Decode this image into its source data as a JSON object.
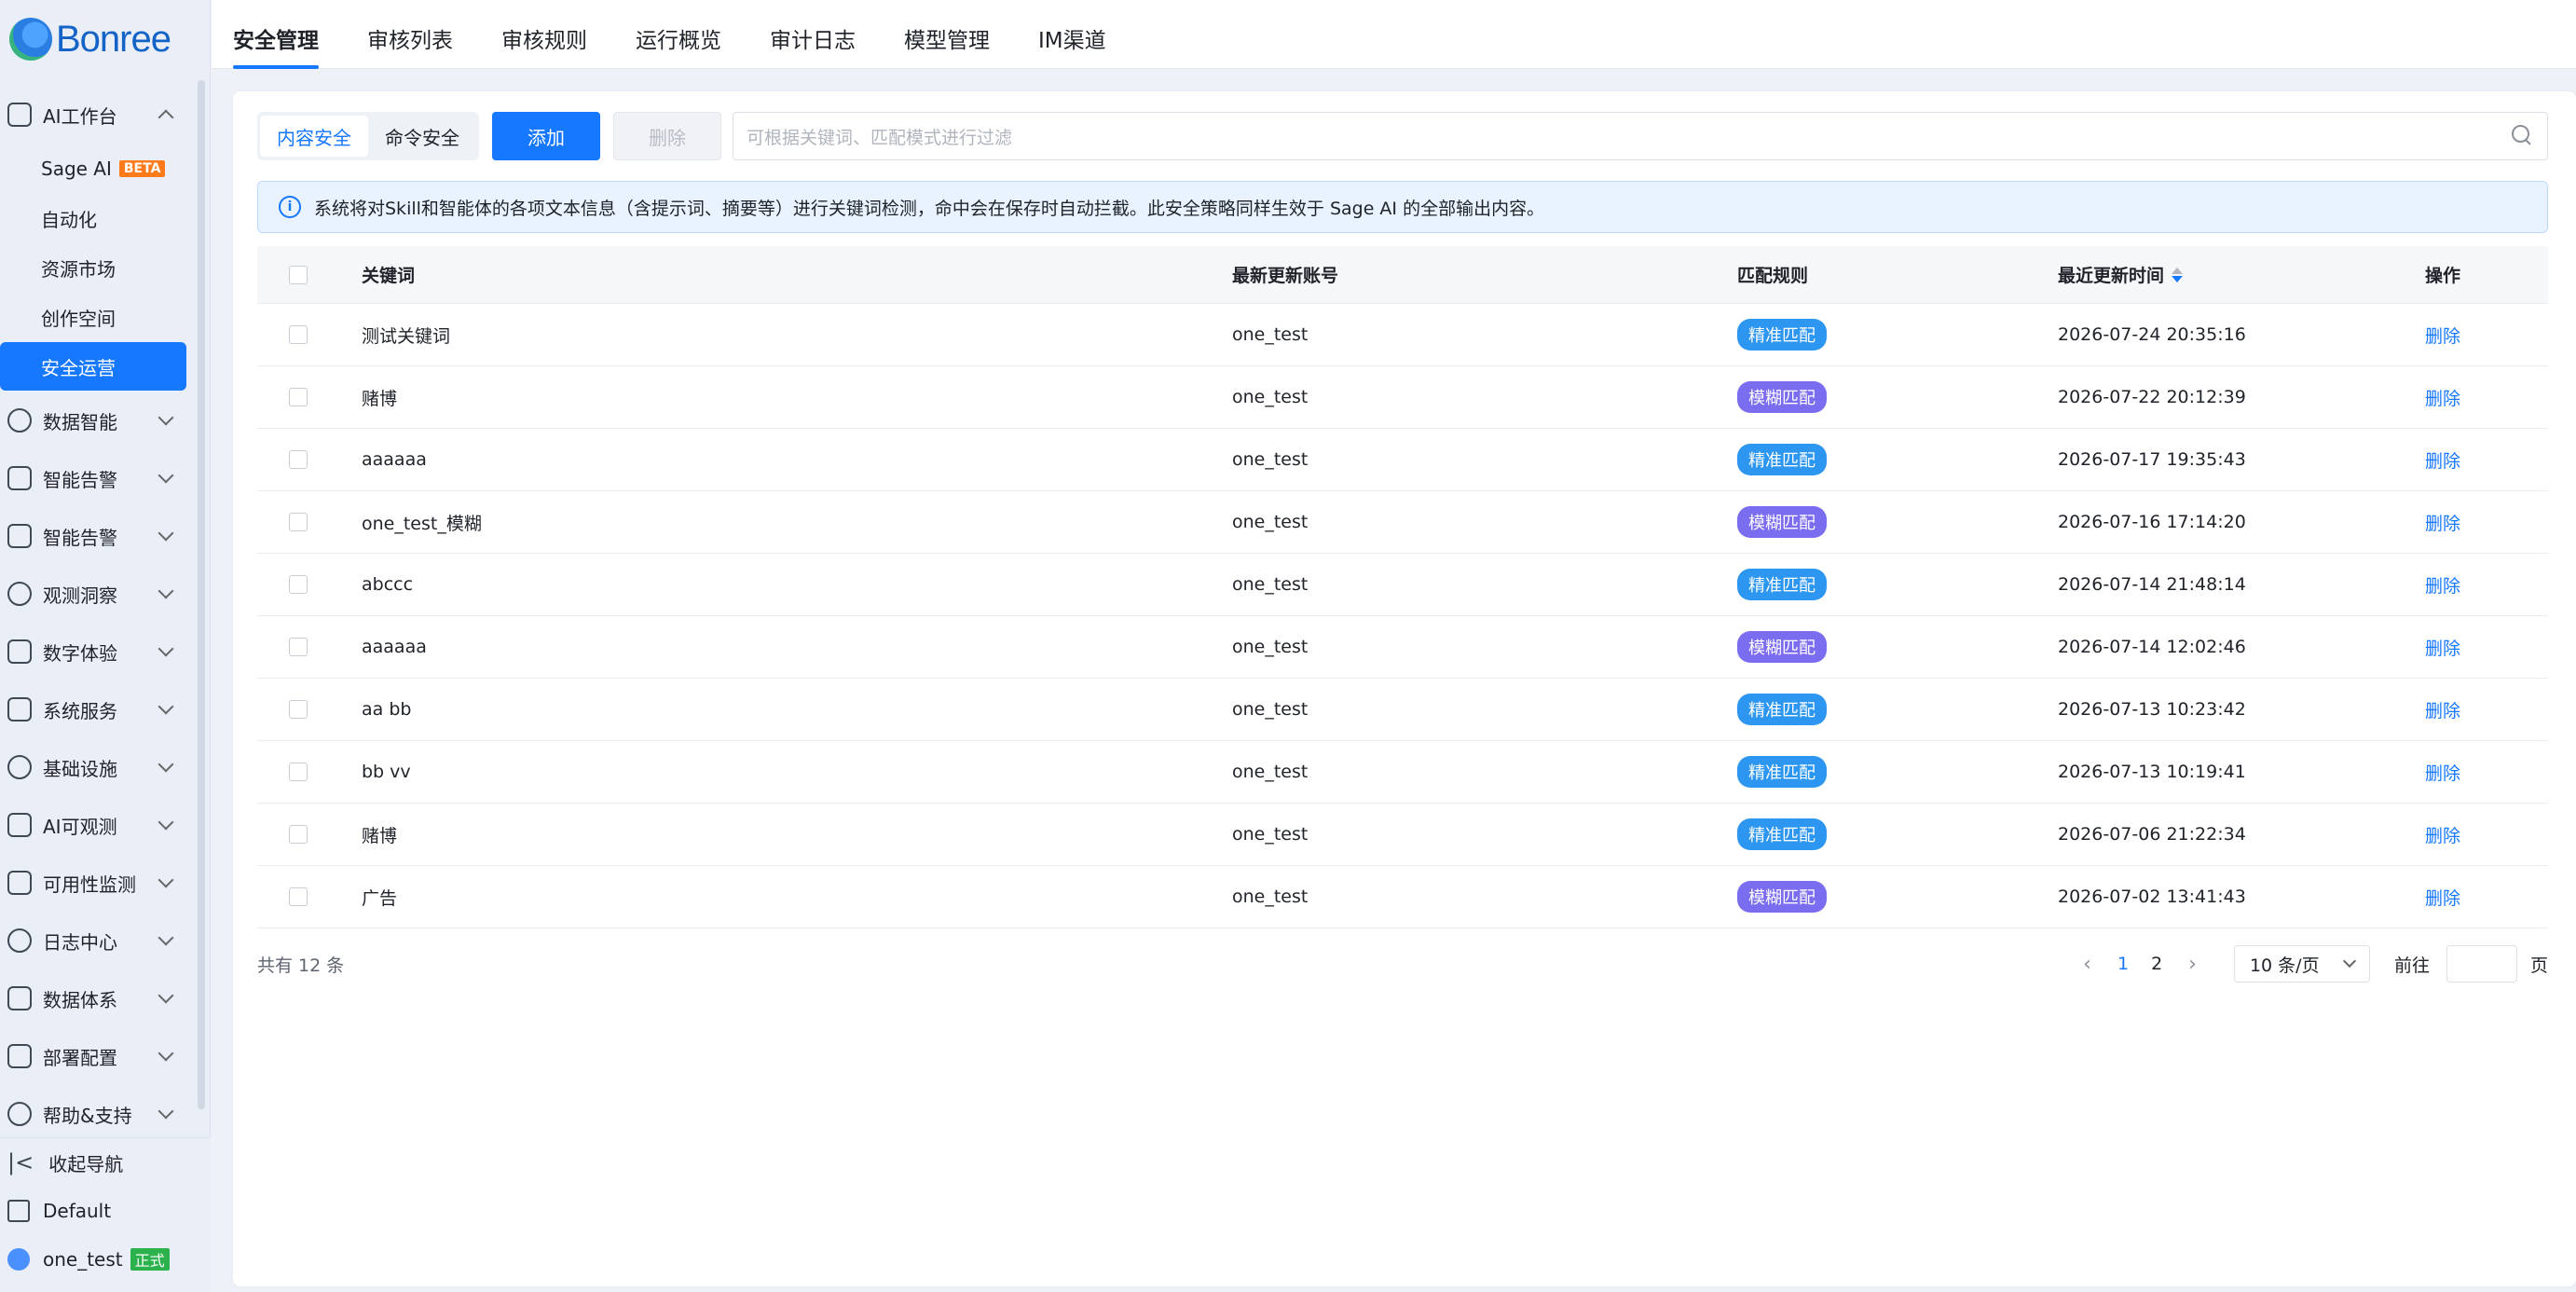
{
  "brand": {
    "name": "Bonree"
  },
  "sidebar": {
    "groups": [
      {
        "label": "AI工作台",
        "expanded": true,
        "icon": "ai-workbench-icon",
        "items": [
          {
            "label": "Sage AI",
            "badge": "BETA"
          },
          {
            "label": "自动化"
          },
          {
            "label": "资源市场"
          },
          {
            "label": "创作空间"
          },
          {
            "label": "安全运营",
            "active": true
          }
        ]
      },
      {
        "label": "数据智能",
        "icon": "chart-line-icon"
      },
      {
        "label": "智能告警",
        "icon": "alarm-icon"
      },
      {
        "label": "智能告警",
        "icon": "alarm-icon"
      },
      {
        "label": "观测洞察",
        "icon": "insight-icon"
      },
      {
        "label": "数字体验",
        "icon": "user-experience-icon"
      },
      {
        "label": "系统服务",
        "icon": "system-service-icon"
      },
      {
        "label": "基础设施",
        "icon": "infrastructure-icon"
      },
      {
        "label": "AI可观测",
        "icon": "ai-observe-icon"
      },
      {
        "label": "可用性监测",
        "icon": "availability-icon"
      },
      {
        "label": "日志中心",
        "icon": "log-icon"
      },
      {
        "label": "数据体系",
        "icon": "data-system-icon"
      },
      {
        "label": "部署配置",
        "icon": "wrench-icon"
      },
      {
        "label": "帮助&支持",
        "icon": "book-icon"
      }
    ],
    "bottom": {
      "collapse_label": "收起导航",
      "workspace_label": "Default",
      "user_name": "one_test",
      "user_tag": "正式"
    }
  },
  "tabs": [
    {
      "label": "安全管理",
      "active": true
    },
    {
      "label": "审核列表"
    },
    {
      "label": "审核规则"
    },
    {
      "label": "运行概览"
    },
    {
      "label": "审计日志"
    },
    {
      "label": "模型管理"
    },
    {
      "label": "IM渠道"
    }
  ],
  "toolbar": {
    "segments": [
      {
        "label": "内容安全",
        "selected": true
      },
      {
        "label": "命令安全"
      }
    ],
    "add_label": "添加",
    "delete_label": "删除",
    "search_placeholder": "可根据关键词、匹配模式进行过滤"
  },
  "notice": {
    "text": "系统将对Skill和智能体的各项文本信息（含提示词、摘要等）进行关键词检测，命中会在保存时自动拦截。此安全策略同样生效于 Sage AI 的全部输出内容。"
  },
  "table": {
    "columns": [
      "关键词",
      "最新更新账号",
      "匹配规则",
      "最近更新时间",
      "操作"
    ],
    "rows": [
      {
        "keyword": "测试关键词",
        "account": "one_test",
        "rule": "精准匹配",
        "rule_type": "exact",
        "time": "2026-07-24 20:35:16",
        "action": "删除"
      },
      {
        "keyword": "赌博",
        "account": "one_test",
        "rule": "模糊匹配",
        "rule_type": "fuzzy",
        "time": "2026-07-22 20:12:39",
        "action": "删除"
      },
      {
        "keyword": "aaaaaa",
        "account": "one_test",
        "rule": "精准匹配",
        "rule_type": "exact",
        "time": "2026-07-17 19:35:43",
        "action": "删除"
      },
      {
        "keyword": "one_test_模糊",
        "account": "one_test",
        "rule": "模糊匹配",
        "rule_type": "fuzzy",
        "time": "2026-07-16 17:14:20",
        "action": "删除"
      },
      {
        "keyword": "abccc",
        "account": "one_test",
        "rule": "精准匹配",
        "rule_type": "exact",
        "time": "2026-07-14 21:48:14",
        "action": "删除"
      },
      {
        "keyword": "aaaaaa",
        "account": "one_test",
        "rule": "模糊匹配",
        "rule_type": "fuzzy",
        "time": "2026-07-14 12:02:46",
        "action": "删除"
      },
      {
        "keyword": "aa bb",
        "account": "one_test",
        "rule": "精准匹配",
        "rule_type": "exact",
        "time": "2026-07-13 10:23:42",
        "action": "删除"
      },
      {
        "keyword": "bb vv",
        "account": "one_test",
        "rule": "精准匹配",
        "rule_type": "exact",
        "time": "2026-07-13 10:19:41",
        "action": "删除"
      },
      {
        "keyword": "赌博",
        "account": "one_test",
        "rule": "精准匹配",
        "rule_type": "exact",
        "time": "2026-07-06 21:22:34",
        "action": "删除"
      },
      {
        "keyword": "广告",
        "account": "one_test",
        "rule": "模糊匹配",
        "rule_type": "fuzzy",
        "time": "2026-07-02 13:41:43",
        "action": "删除"
      }
    ]
  },
  "pagination": {
    "total_text": "共有 12 条",
    "pages": [
      "1",
      "2"
    ],
    "current_page": "1",
    "page_size": "10 条/页",
    "goto_label": "前往",
    "goto_suffix": "页"
  },
  "colors": {
    "primary": "#1677ff",
    "exact_tag": "#2c96f0",
    "fuzzy_tag": "#7a6df0",
    "beta_badge": "#ff7a1a",
    "prod_tag": "#2bb24c"
  }
}
